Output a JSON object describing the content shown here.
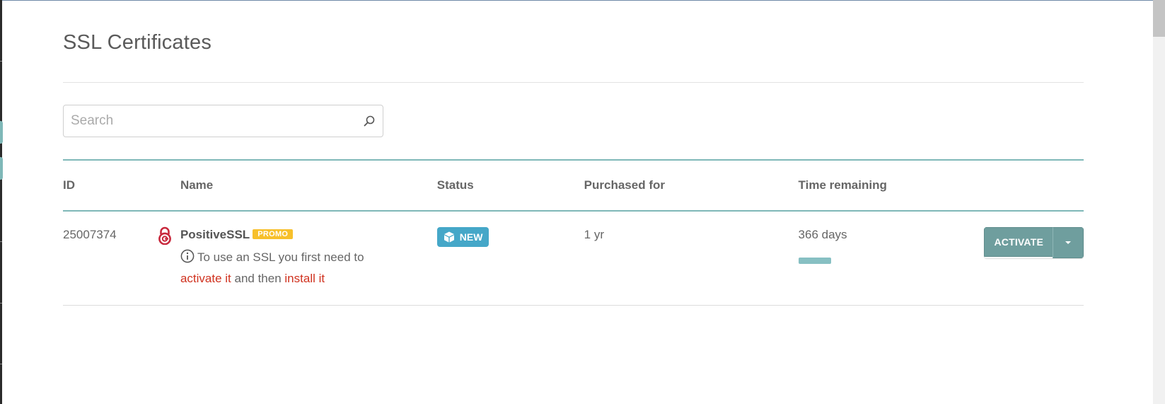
{
  "page": {
    "title": "SSL Certificates"
  },
  "search": {
    "placeholder": "Search",
    "value": ""
  },
  "table": {
    "columns": [
      "ID",
      "Name",
      "Status",
      "Purchased for",
      "Time remaining"
    ],
    "rows": [
      {
        "id": "25007374",
        "name": "PositiveSSL",
        "badge": "PROMO",
        "help_prefix": "To use an SSL you first need to",
        "help_link1": "activate it",
        "help_middle": "and then",
        "help_link2": "install it",
        "status": "NEW",
        "purchased_for": "1 yr",
        "time_remaining": "366 days",
        "time_remaining_fraction": 1.0,
        "action_label": "ACTIVATE"
      }
    ]
  },
  "colors": {
    "accent_teal": "#7fb8b8",
    "status_new": "#45a7c8",
    "promo": "#f7c02b",
    "link_red": "#d0321f",
    "button": "#6f9e9e"
  },
  "icons": {
    "search": "search-icon",
    "lock": "lock-icon",
    "info": "info-icon",
    "status": "cube-icon",
    "dropdown": "chevron-down-icon"
  }
}
